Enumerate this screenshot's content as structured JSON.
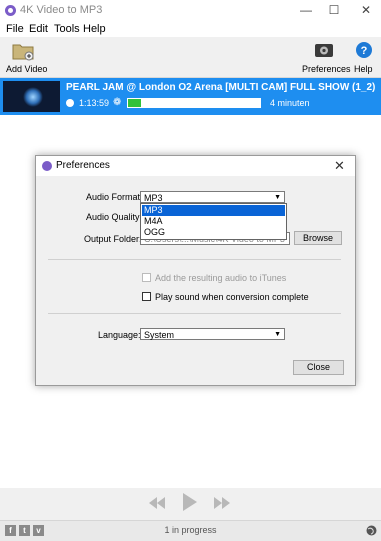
{
  "window": {
    "title": "4K Video to MP3"
  },
  "menu": [
    "File",
    "Edit",
    "Tools",
    "Help"
  ],
  "toolbar": {
    "add_video": "Add Video",
    "preferences": "Preferences",
    "help": "Help"
  },
  "item": {
    "title": "PEARL JAM @ London O2 Arena [MULTI CAM] FULL SHOW (1_2)",
    "duration": "1:13:59",
    "progress": 0.1,
    "eta": "4 minuten"
  },
  "status": {
    "text": "1 in progress"
  },
  "social": [
    "f",
    "t",
    "v"
  ],
  "dialog": {
    "title": "Preferences",
    "close_glyph": "✕",
    "audio_format_label": "Audio Format:",
    "audio_format_value": "MP3",
    "audio_quality_label": "Audio Quality:",
    "output_folder_label": "Output Folder:",
    "output_folder_value": "C:\\Users\\...\\Music\\4K Video to MP3",
    "browse_label": "Browse",
    "itunes_label": "Add the resulting audio to iTunes",
    "play_sound_label": "Play sound when conversion complete",
    "language_label": "Language:",
    "language_value": "System",
    "close_label": "Close",
    "format_options": [
      "MP3",
      "M4A",
      "OGG"
    ]
  },
  "colors": {
    "accent": "#1e8ef0",
    "selection": "#0a64d6",
    "progress": "#31c23a"
  }
}
